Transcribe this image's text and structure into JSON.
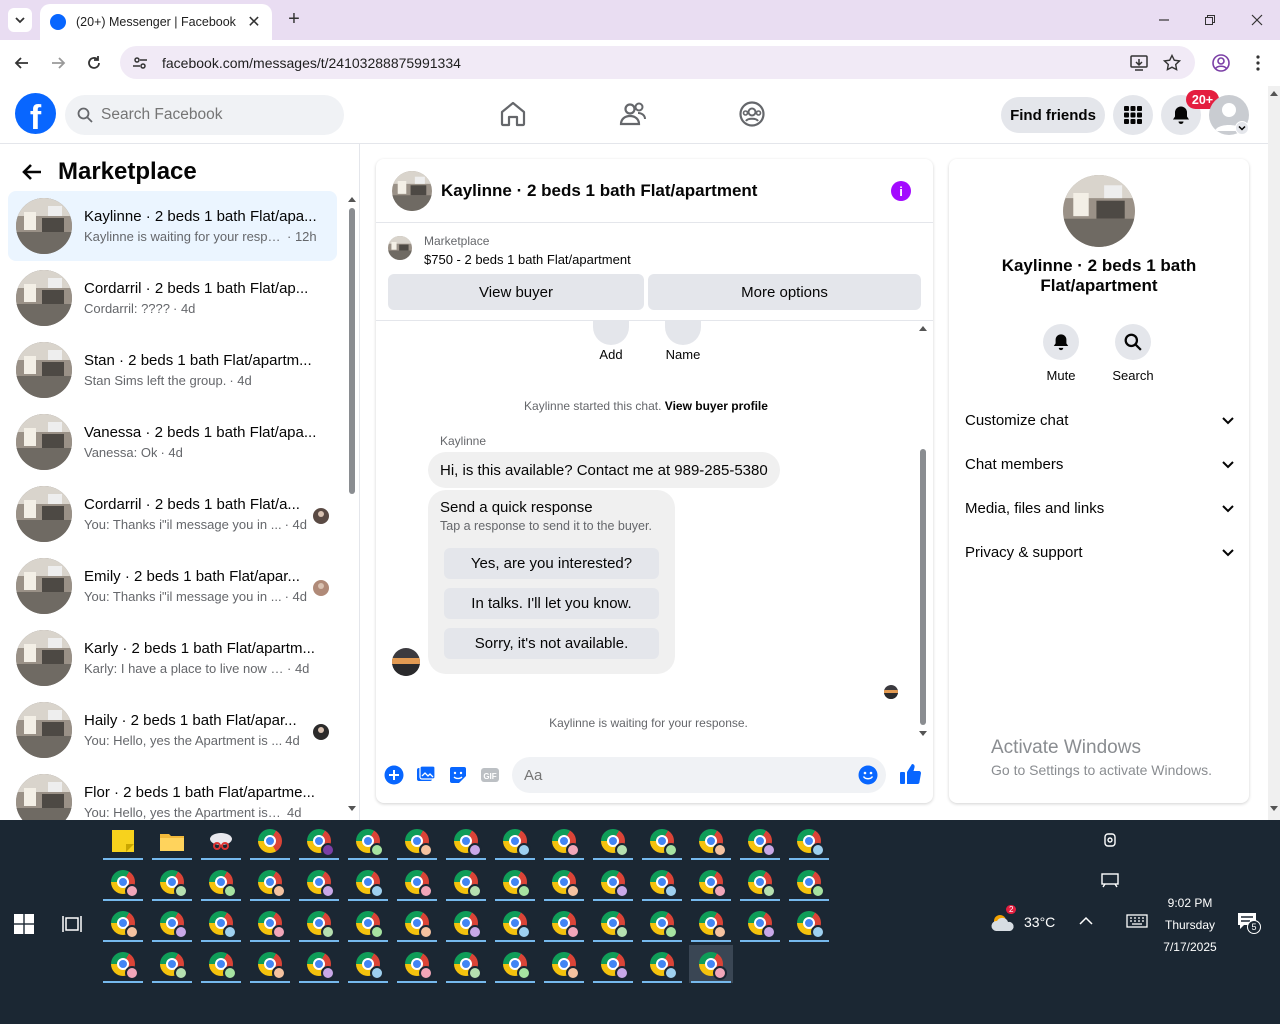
{
  "browser": {
    "tab_title": "(20+) Messenger | Facebook",
    "url": "facebook.com/messages/t/24103288875991334"
  },
  "fb": {
    "search_placeholder": "Search Facebook",
    "find_friends": "Find friends",
    "notif_badge": "20+",
    "logo_letter": "f"
  },
  "left": {
    "title": "Marketplace",
    "conversations": [
      {
        "name": "Kaylinne · 2 beds 1 bath Flat/apa...",
        "preview": "Kaylinne is waiting for your respo...",
        "time": "· 12h"
      },
      {
        "name": "Cordarril · 2 beds 1 bath Flat/ap...",
        "preview": "Cordarril: ????",
        "time": "· 4d"
      },
      {
        "name": "Stan · 2 beds 1 bath Flat/apartm...",
        "preview": "Stan Sims left the group.",
        "time": "· 4d"
      },
      {
        "name": "Vanessa · 2 beds 1 bath Flat/apa...",
        "preview": "Vanessa: Ok",
        "time": "· 4d"
      },
      {
        "name": "Cordarril · 2 beds 1 bath Flat/a...",
        "preview": "You: Thanks i\"il message you in ...",
        "time": "· 4d"
      },
      {
        "name": "Emily · 2 beds 1 bath Flat/apar...",
        "preview": "You: Thanks i\"il message you in ...",
        "time": "· 4d"
      },
      {
        "name": "Karly · 2 beds 1 bath Flat/apartm...",
        "preview": "Karly: I have a place to live now tha...",
        "time": "· 4d"
      },
      {
        "name": "Haily · 2 beds 1 bath Flat/apar...",
        "preview": "You: Hello, yes the Apartment is ...",
        "time": "4d"
      },
      {
        "name": "Flor · 2 beds 1 bath Flat/apartme...",
        "preview": "You: Hello, yes the Apartment is stil...",
        "time": "4d"
      }
    ]
  },
  "chat": {
    "title": "Kaylinne · 2 beds 1 bath Flat/apartment",
    "marketplace_label": "Marketplace",
    "listing": "$750 - 2 beds 1 bath Flat/apartment",
    "view_buyer": "View buyer",
    "more_options": "More options",
    "add_label": "Add",
    "name_label": "Name",
    "started_text": "Kaylinne started this chat.",
    "view_profile": "View buyer profile",
    "sender": "Kaylinne",
    "message": "Hi, is this available? Contact me at 989-285-5380",
    "quick_title": "Send a quick response",
    "quick_sub": "Tap a response to send it to the buyer.",
    "quick_options": [
      "Yes, are you interested?",
      "In talks. I'll let you know.",
      "Sorry, it's not available."
    ],
    "waiting": "Kaylinne is waiting for your response.",
    "input_placeholder": "Aa"
  },
  "right": {
    "name": "Kaylinne · 2 beds 1 bath Flat/apartment",
    "mute": "Mute",
    "search": "Search",
    "sections": [
      "Customize chat",
      "Chat members",
      "Media, files and links",
      "Privacy & support"
    ],
    "activate_title": "Activate Windows",
    "activate_sub": "Go to Settings to activate Windows."
  },
  "taskbar": {
    "temperature": "33°C",
    "weather_badge": "2",
    "time": "9:02 PM",
    "day": "Thursday",
    "date": "7/17/2025",
    "notifications": "5"
  },
  "colors": {
    "fb_blue": "#0866ff",
    "active_conv": "#ebf5ff",
    "badge_red": "#e41e3f",
    "info_purple": "#a30aff",
    "taskbar": "#1b2733"
  }
}
